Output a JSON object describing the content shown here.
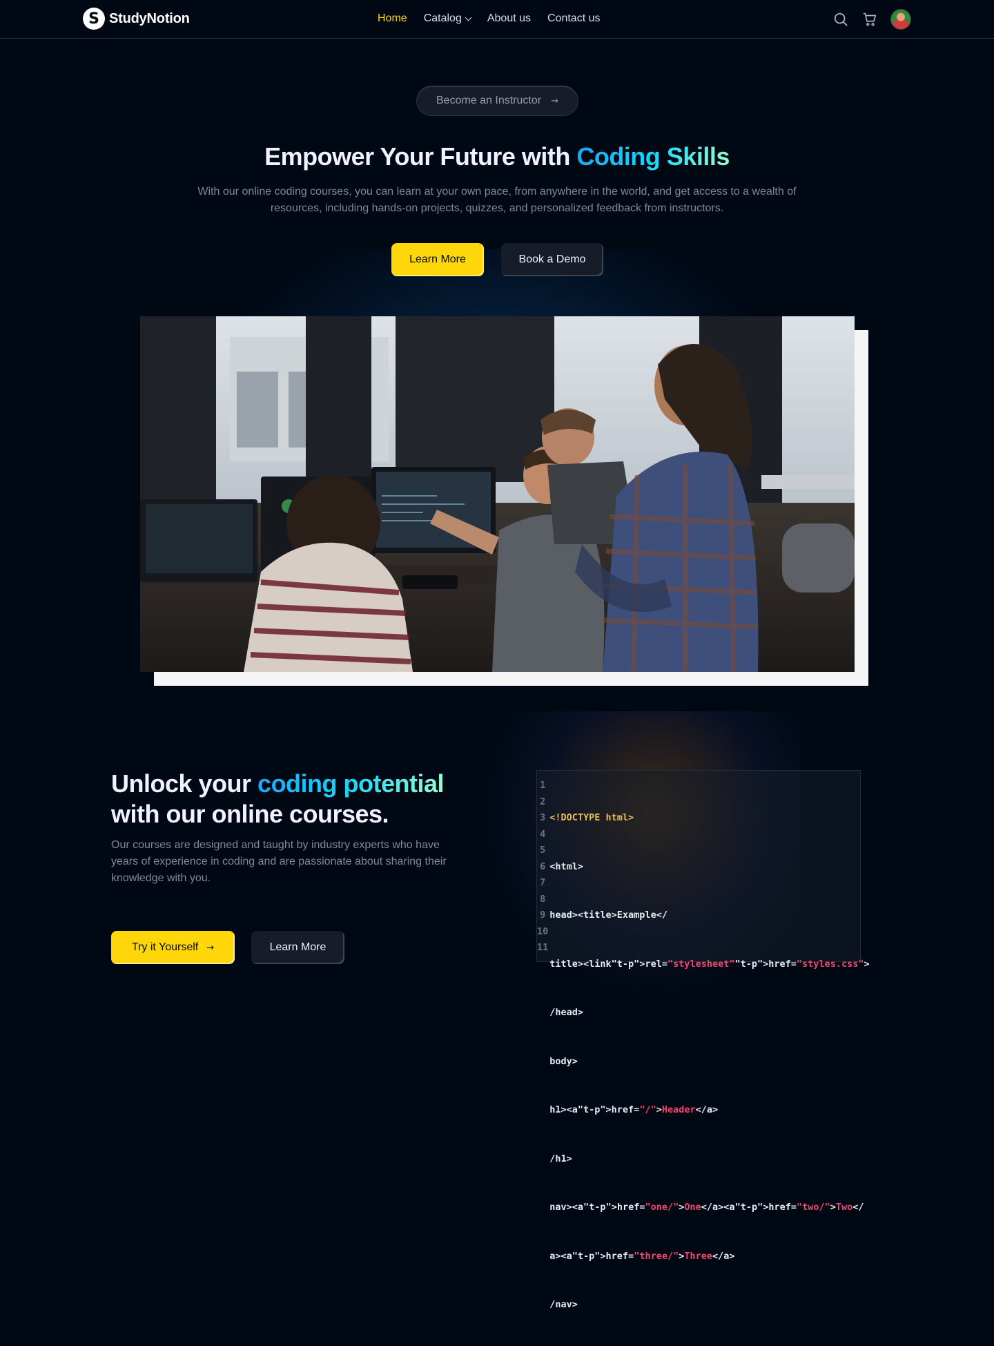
{
  "brand": {
    "name": "StudyNotion",
    "mark": "S"
  },
  "nav": {
    "links": [
      {
        "label": "Home",
        "active": true
      },
      {
        "label": "Catalog",
        "has_dropdown": true
      },
      {
        "label": "About us"
      },
      {
        "label": "Contact us"
      }
    ],
    "icons": [
      "search-icon",
      "cart-icon",
      "avatar"
    ]
  },
  "hero": {
    "instructor_label": "Become an Instructor",
    "title_plain": "Empower Your Future with ",
    "title_highlight": "Coding Skills",
    "subtitle": "With our online coding courses, you can learn at your own pace, from anywhere in the world, and get access to a wealth of resources, including hands-on projects, quizzes, and personalized feedback from instructors.",
    "primary_button": "Learn More",
    "secondary_button": "Book a Demo"
  },
  "code_section": {
    "title_plain_1": "Unlock your ",
    "title_highlight": "coding potential",
    "title_plain_2": "with our online courses.",
    "subtitle": "Our courses are designed and taught by industry experts who have years of experience in coding and are passionate about sharing their knowledge with you.",
    "primary_button": "Try it Yourself",
    "secondary_button": "Learn More",
    "line_numbers": [
      "1",
      "2",
      "3",
      "4",
      "5",
      "6",
      "7",
      "8",
      "9",
      "10",
      "11"
    ],
    "code_lines": [
      "<!DOCTYPE html>",
      "<html>",
      "head><title>Example</",
      "title><linkrel=\"stylesheet\"href=\"styles.css\">",
      "/head>",
      "body>",
      "h1><ahref=\"/\">Header</a>",
      "/h1>",
      "nav><ahref=\"one/\">One</a><ahref=\"two/\">Two</",
      "a><ahref=\"three/\">Three</a>",
      "/nav>"
    ]
  },
  "colors": {
    "accent_yellow": "#FFD60A",
    "background": "#000814",
    "gradient": [
      "#1FA2FF",
      "#12D8FA",
      "#A6FFCB"
    ]
  }
}
